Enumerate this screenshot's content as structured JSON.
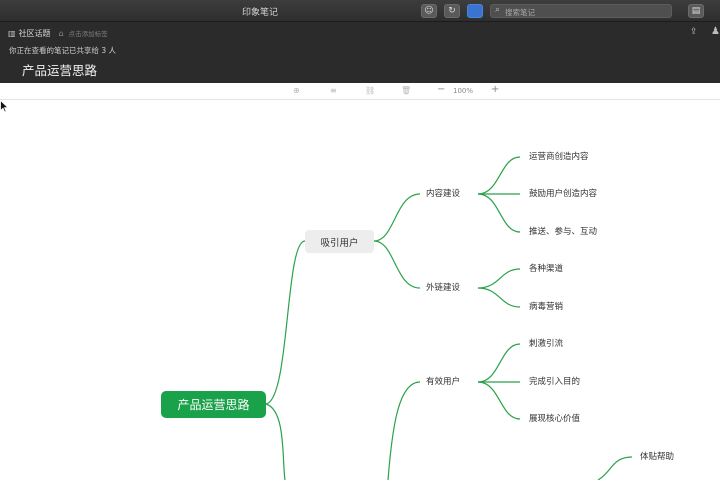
{
  "window": {
    "title": "印象笔记"
  },
  "search": {
    "placeholder": "搜索笔记"
  },
  "note": {
    "notebook": "社区话题",
    "tag_placeholder": "点击添加标签",
    "shared_info": "你正在查看的笔记已共享给 3 人",
    "title": "产品运营思路"
  },
  "toolbar": {
    "zoom": "100%",
    "zoom_out": "−",
    "zoom_in": "+"
  },
  "mindmap": {
    "root": "产品运营思路",
    "branch": "吸引用户",
    "content_building": {
      "label": "内容建设",
      "children": [
        "运营商创造内容",
        "鼓励用户创造内容",
        "推送、参与、互动"
      ]
    },
    "link_building": {
      "label": "外链建设",
      "children": [
        "各种渠道",
        "病毒营销"
      ]
    },
    "effective_users": {
      "label": "有效用户",
      "children": [
        "刺激引流",
        "完成引入目的",
        "展现核心价值"
      ]
    },
    "partial": [
      "体贴帮助"
    ]
  },
  "colors": {
    "accent": "#1aa24a",
    "branch_line": "#2aa24a",
    "header_bg": "#2b2b2b"
  }
}
